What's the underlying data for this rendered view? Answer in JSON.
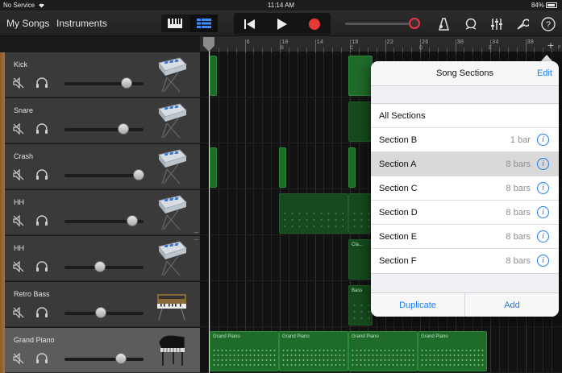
{
  "status_bar": {
    "carrier": "No Service",
    "time": "11:14 AM",
    "battery": "84%"
  },
  "toolbar": {
    "my_songs": "My Songs",
    "instruments": "Instruments",
    "view_icons": [
      "keyboard-icon",
      "tracks-view-icon"
    ],
    "transport_icons": [
      "rewind-icon",
      "play-icon",
      "record-icon"
    ],
    "record_color": "#e53935",
    "right_icons": [
      "metronome-icon",
      "loop-icon",
      "mixer-icon",
      "settings-wrench-icon",
      "help-icon"
    ]
  },
  "ruler": {
    "bars": [
      "2",
      "6",
      "10",
      "14",
      "18",
      "22",
      "26",
      "30",
      "34",
      "38"
    ],
    "sections": [
      "B",
      "C",
      "D",
      "E",
      "F"
    ]
  },
  "tracks": [
    {
      "name": "Kick",
      "volume": 0.79,
      "instrument": "drum-machine-icon"
    },
    {
      "name": "Snare",
      "volume": 0.74,
      "instrument": "drum-machine-icon"
    },
    {
      "name": "Crash",
      "volume": 0.94,
      "instrument": "drum-machine-icon"
    },
    {
      "name": "HH",
      "volume": 0.86,
      "instrument": "drum-machine-icon"
    },
    {
      "name": "HH",
      "volume": 0.45,
      "instrument": "drum-machine-icon"
    },
    {
      "name": "Retro Bass",
      "volume": 0.46,
      "instrument": "synth-keyboard-icon"
    },
    {
      "name": "Grand Piano",
      "volume": 0.71,
      "instrument": "grand-piano-icon",
      "selected": true
    }
  ],
  "region_labels": {
    "hh": "Cla...",
    "bass": "Bass",
    "piano": [
      "Grand Piano",
      "Grand Piano",
      "Grand Piano",
      "Grand Piano"
    ]
  },
  "song_sections": {
    "title": "Song Sections",
    "edit": "Edit",
    "all_sections": "All Sections",
    "sections": [
      {
        "name": "Section B",
        "length": "1 bar"
      },
      {
        "name": "Section A",
        "length": "8 bars",
        "selected": true
      },
      {
        "name": "Section C",
        "length": "8 bars"
      },
      {
        "name": "Section D",
        "length": "8 bars"
      },
      {
        "name": "Section E",
        "length": "8 bars"
      },
      {
        "name": "Section F",
        "length": "8 bars"
      }
    ],
    "duplicate": "Duplicate",
    "add": "Add"
  }
}
